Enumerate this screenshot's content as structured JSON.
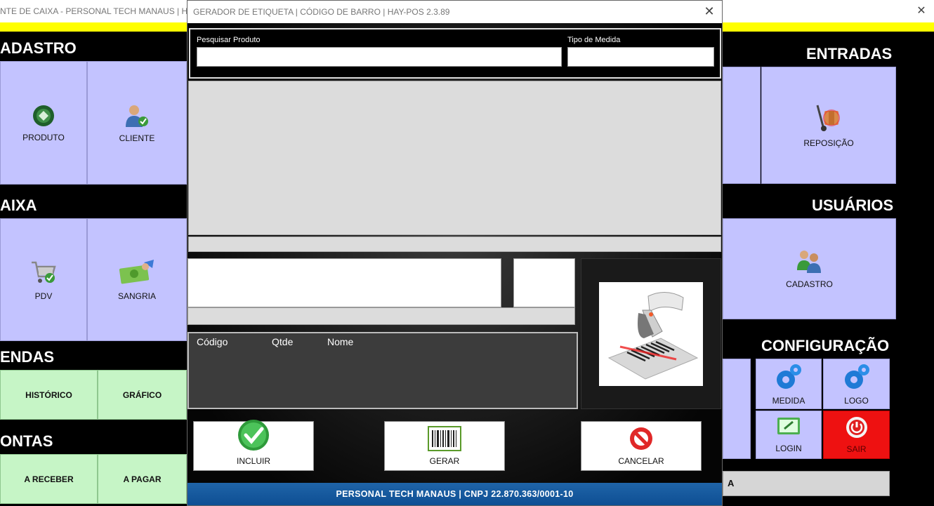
{
  "main_window": {
    "title": "NTE DE CAIXA - PERSONAL TECH MANAUS | HAY-",
    "close_glyph": "✕",
    "sections": {
      "cadastro": "ADASTRO",
      "caixa": "AIXA",
      "vendas": "ENDAS",
      "contas": "ONTAS",
      "entradas": "ENTRADAS",
      "usuarios": "USUÁRIOS",
      "configuracao": "CONFIGURAÇÃO"
    },
    "tiles": {
      "produto": "PRODUTO",
      "cliente": "CLIENTE",
      "pdv": "PDV",
      "sangria": "SANGRIA",
      "historico": "HISTÓRICO",
      "grafico": "GRÁFICO",
      "a_receber": "A RECEBER",
      "a_pagar": "A PAGAR",
      "reposicao": "REPOSIÇÃO",
      "cadastro_usuarios": "CADASTRO",
      "medida": "MEDIDA",
      "logo": "LOGO",
      "login": "LOGIN",
      "sair": "SAIR"
    },
    "bottom_bar_text": "A",
    "colors": {
      "yellow": "#ffff00",
      "tile_purple": "#c3c3ff",
      "tile_green": "#c6f5c6",
      "exit_red": "#ee1111"
    }
  },
  "modal": {
    "title": "GERADOR DE ETIQUETA | CÓDIGO DE BARRO | HAY-POS 2.3.89",
    "close_glyph": "✕",
    "search_label": "Pesquisar Produto",
    "search_value": "",
    "measure_label": "Tipo de Medida",
    "measure_value": "",
    "list_columns": [
      "Código",
      "Qtde",
      "Nome"
    ],
    "buttons": {
      "incluir": "INCLUIR",
      "gerar": "GERAR",
      "cancelar": "CANCELAR"
    },
    "footer": "PERSONAL TECH MANAUS | CNPJ 22.870.363/0001-10",
    "colors": {
      "footer_blue": "#1a5fa5"
    }
  }
}
